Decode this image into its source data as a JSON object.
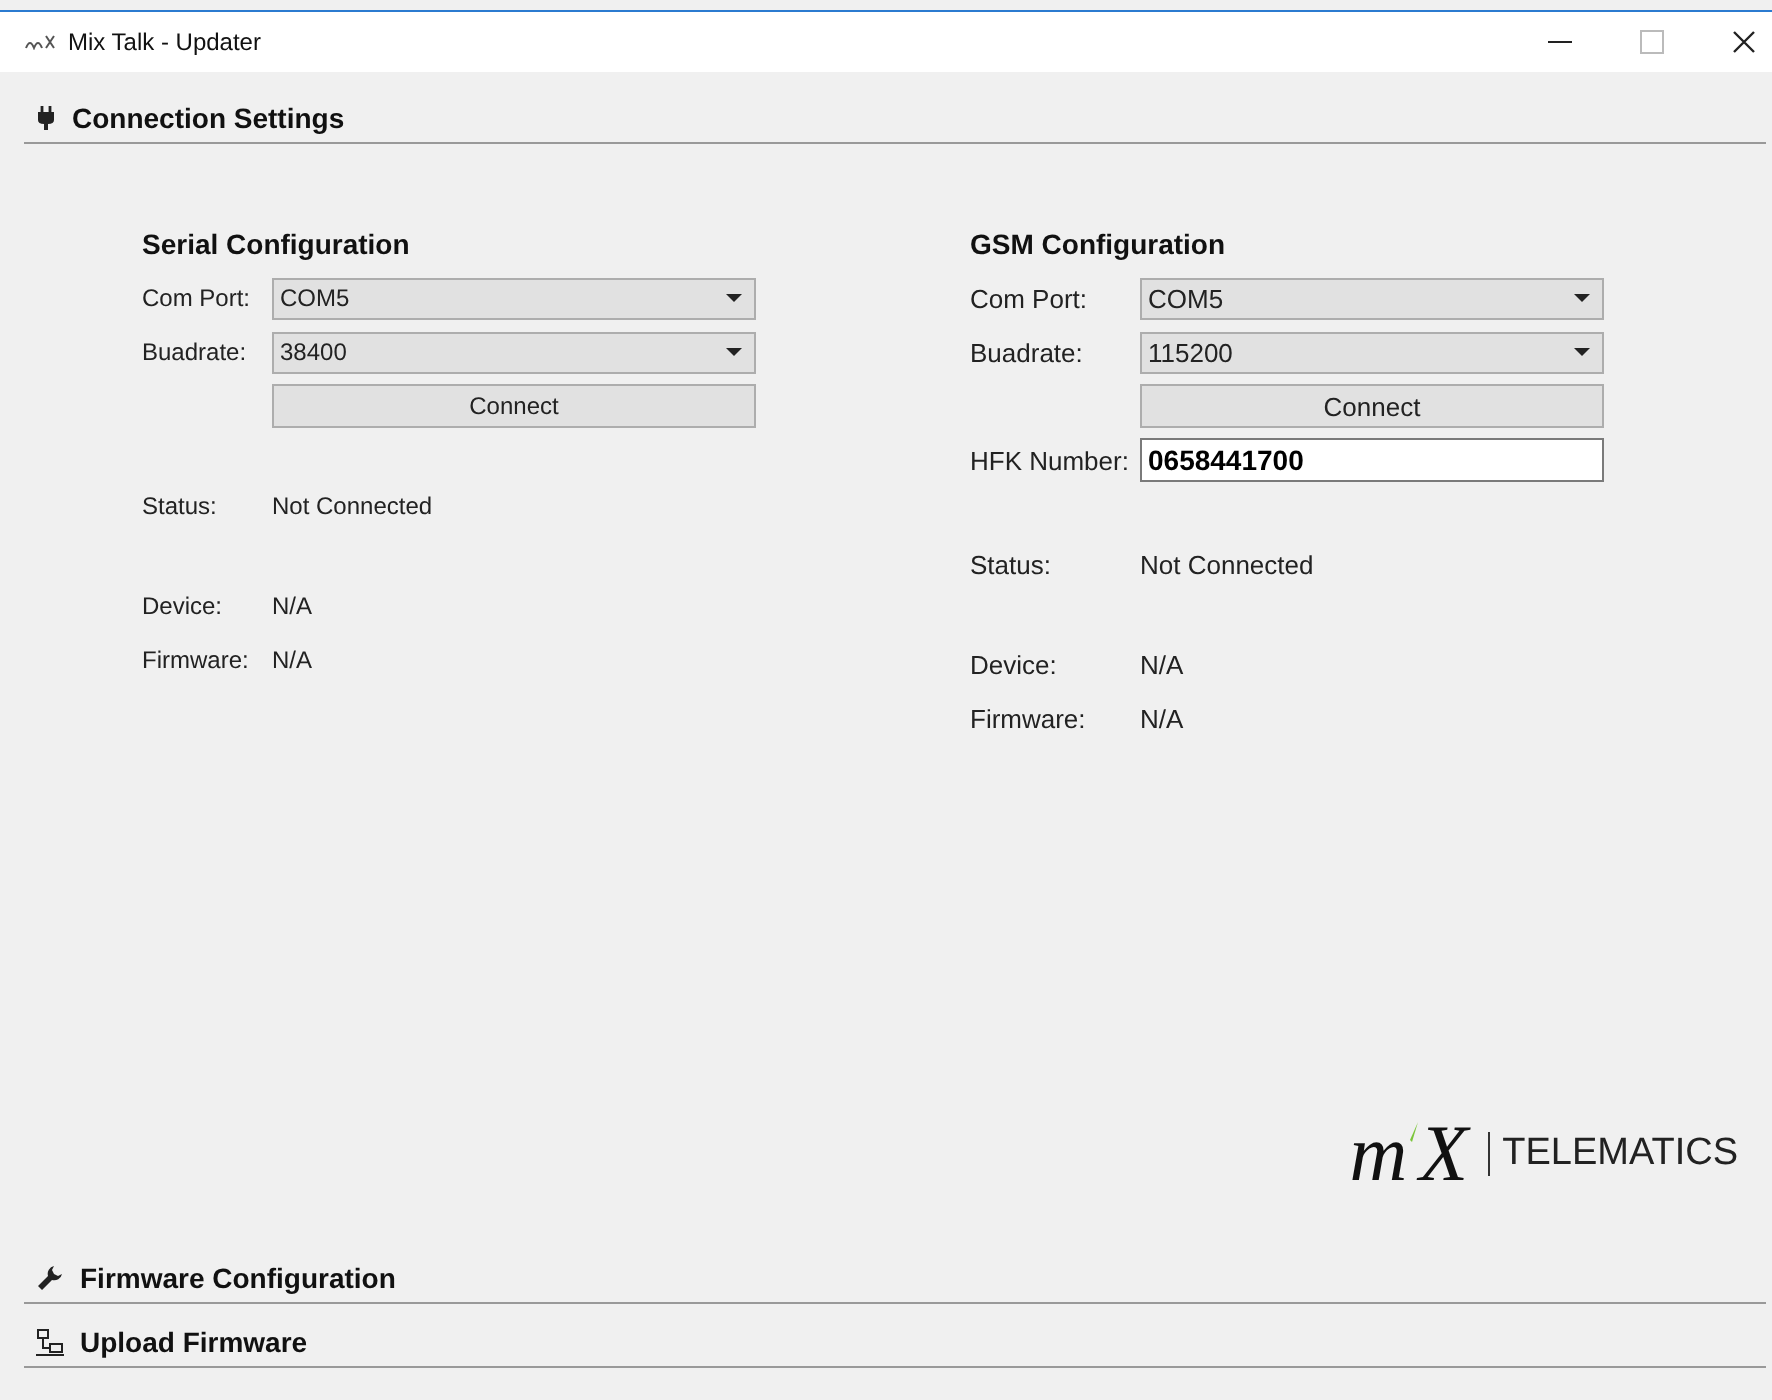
{
  "window": {
    "title": "Mix Talk - Updater"
  },
  "sections": [
    {
      "title": "Connection Settings",
      "kind": "plug",
      "panels": [
        {
          "title": "Serial Configuration",
          "rows": [
            {
              "kind": "select",
              "label": "Com Port:",
              "value": "COM5"
            },
            {
              "kind": "select",
              "label": "Buadrate:",
              "value": "38400"
            },
            {
              "kind": "button",
              "value": "Connect"
            },
            {
              "kind": "status",
              "label": "Status:",
              "value": "Not Connected"
            },
            {
              "kind": "detail",
              "label": "Device:",
              "value": "N/A"
            },
            {
              "kind": "detail",
              "label": "Firmware:",
              "value": "N/A"
            }
          ]
        },
        {
          "title": "GSM Configuration",
          "rows": [
            {
              "kind": "select",
              "label": "Com Port:",
              "value": "COM5"
            },
            {
              "kind": "select",
              "label": "Buadrate:",
              "value": "115200"
            },
            {
              "kind": "button",
              "value": "Connect"
            },
            {
              "kind": "input",
              "label": "HFK Number:",
              "value": "0658441700"
            },
            {
              "kind": "status",
              "label": "Status:",
              "value": "Not Connected"
            },
            {
              "kind": "detail",
              "label": "Device:",
              "value": "N/A"
            },
            {
              "kind": "detail",
              "label": "Firmware:",
              "value": "N/A"
            }
          ]
        }
      ],
      "logo": {
        "mark_left": "m",
        "mark_right": "X",
        "company": "TELEMATICS"
      }
    },
    {
      "title": "Firmware Configuration",
      "kind": "wrench"
    },
    {
      "title": "Upload Firmware",
      "kind": "network"
    }
  ]
}
